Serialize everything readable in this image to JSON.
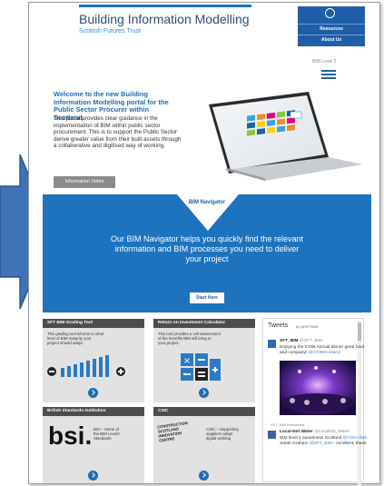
{
  "header": {
    "title": "Building Information Modelling",
    "subtitle": "Scottish Futures Trust",
    "menu": {
      "icon": "compass-icon",
      "items": [
        "Resources",
        "About Us"
      ]
    },
    "bim_level": "BIM Level 2"
  },
  "hero": {
    "title": "Welcome to the new Building Information Modelling portal for the Public Sector Procurer within Scotland.",
    "body": "This portal provides clear guidance in the implementation of BIM within public sector procurement. This is to support the Public Sector derive greater value from their built assets through a collaborative and digitised way of working.",
    "button": "Information Video"
  },
  "navigator": {
    "label": "BIM Navigator",
    "text": "Our BIM Navigator helps you quickly find the relevant information and BIM processes you need to deliver your project",
    "button": "Start Here"
  },
  "tiles": [
    {
      "title": "SFT BIM Grading Tool",
      "text": [
        "This grading tool informs to what",
        "level of BIM maturity your",
        "project should adopt."
      ]
    },
    {
      "title": "Return on Investment Calculator",
      "text": [
        "This tool provides a cell assessment",
        "of the benefits BIM will bring to",
        "your project."
      ]
    },
    {
      "title": "British Standards Institution",
      "logo": "bsi.",
      "text": [
        "BSI – Home of",
        "the BIM Level2",
        "Standards"
      ]
    },
    {
      "title": "CSIC",
      "logo_lines": [
        "CONSTRUCTION",
        "SCOTLAND",
        "INNOVATION",
        "CENTRE"
      ],
      "text": [
        "CSIC – Supporting",
        "suppliers adopt",
        "digital working"
      ]
    }
  ],
  "twitter": {
    "title": "Tweets",
    "by": "by @SFTBIM",
    "tweet1": {
      "name": "SFT_BIM",
      "handle": "@SFT_BIM",
      "text": [
        "Enjoying the CIOB Annual dinner great food",
        "and company!"
      ],
      "link": "@CIOBScotland"
    },
    "retweet_note": "SFT_BIM Retweeted",
    "tweet2": {
      "name": "Local-Not Water",
      "handle": "@LocalNot_Water",
      "text": [
        "BIM level 2 awareness Scotland",
        "Sarah Graham"
      ],
      "link1": "@CSICollab",
      "link2": "@SFT_BIM",
      "tail": "- excellent, thank"
    }
  },
  "colors": {
    "brand_blue": "#1e73be",
    "dark_header": "#4d4d4d",
    "tile_bg": "#e2e2e2"
  }
}
